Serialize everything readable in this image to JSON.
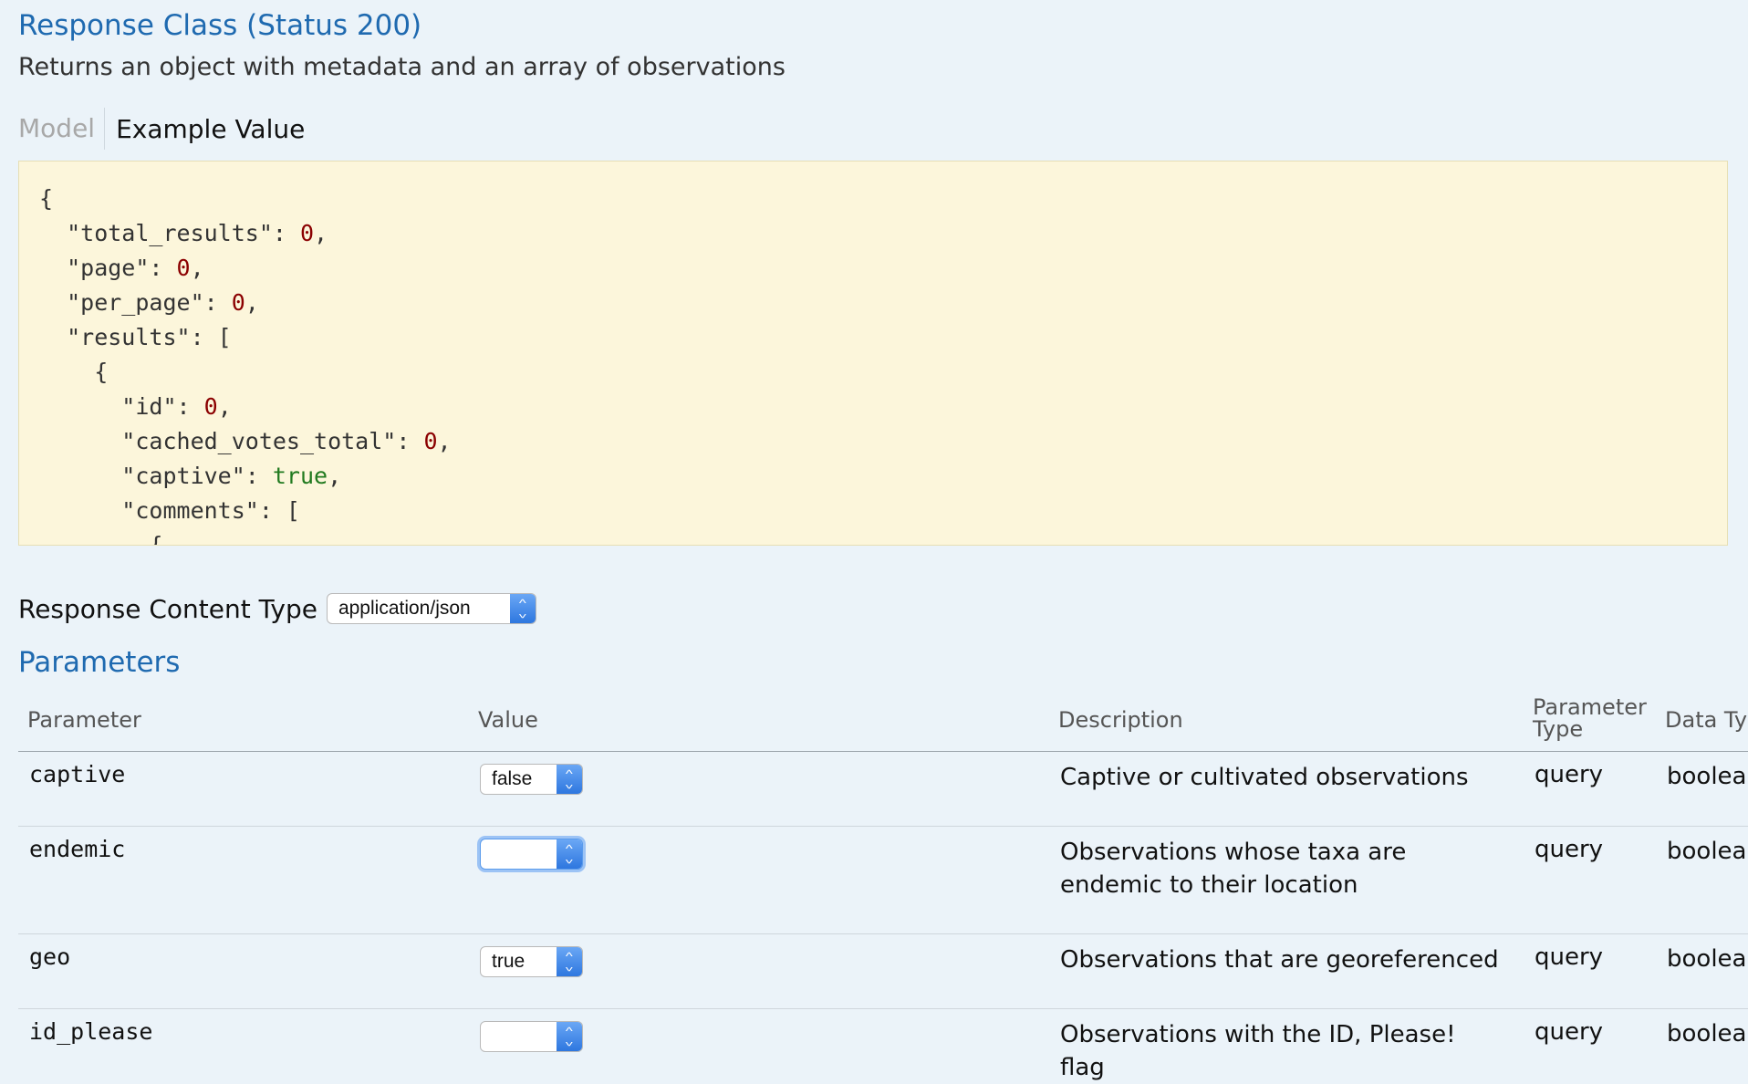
{
  "response_class": {
    "title": "Response Class (Status 200)",
    "description": "Returns an object with metadata and an array of observations"
  },
  "tabs": {
    "model": "Model",
    "example": "Example Value"
  },
  "code_lines": [
    [
      {
        "t": "{"
      }
    ],
    [
      {
        "t": "  \"total_results\": "
      },
      {
        "t": "0",
        "c": "num"
      },
      {
        "t": ","
      }
    ],
    [
      {
        "t": "  \"page\": "
      },
      {
        "t": "0",
        "c": "num"
      },
      {
        "t": ","
      }
    ],
    [
      {
        "t": "  \"per_page\": "
      },
      {
        "t": "0",
        "c": "num"
      },
      {
        "t": ","
      }
    ],
    [
      {
        "t": "  \"results\": ["
      }
    ],
    [
      {
        "t": "    {"
      }
    ],
    [
      {
        "t": "      \"id\": "
      },
      {
        "t": "0",
        "c": "num"
      },
      {
        "t": ","
      }
    ],
    [
      {
        "t": "      \"cached_votes_total\": "
      },
      {
        "t": "0",
        "c": "num"
      },
      {
        "t": ","
      }
    ],
    [
      {
        "t": "      \"captive\": "
      },
      {
        "t": "true",
        "c": "bool"
      },
      {
        "t": ","
      }
    ],
    [
      {
        "t": "      \"comments\": ["
      }
    ],
    [
      {
        "t": "        {"
      }
    ]
  ],
  "response_content_type": {
    "label": "Response Content Type",
    "value": "application/json"
  },
  "parameters": {
    "title": "Parameters",
    "headers": {
      "parameter": "Parameter",
      "value": "Value",
      "description": "Description",
      "parameter_type_1": "Parameter",
      "parameter_type_2": "Type",
      "data_type": "Data Type"
    },
    "rows": [
      {
        "name": "captive",
        "value": "false",
        "description": "Captive or cultivated observations",
        "param_type": "query",
        "data_type": "boolean"
      },
      {
        "name": "endemic",
        "value": "",
        "description": "Observations whose taxa are endemic to their location",
        "param_type": "query",
        "data_type": "boolean"
      },
      {
        "name": "geo",
        "value": "true",
        "description": "Observations that are georeferenced",
        "param_type": "query",
        "data_type": "boolean"
      },
      {
        "name": "id_please",
        "value": "",
        "description": "Observations with the ID, Please! flag",
        "param_type": "query",
        "data_type": "boolean"
      }
    ]
  }
}
